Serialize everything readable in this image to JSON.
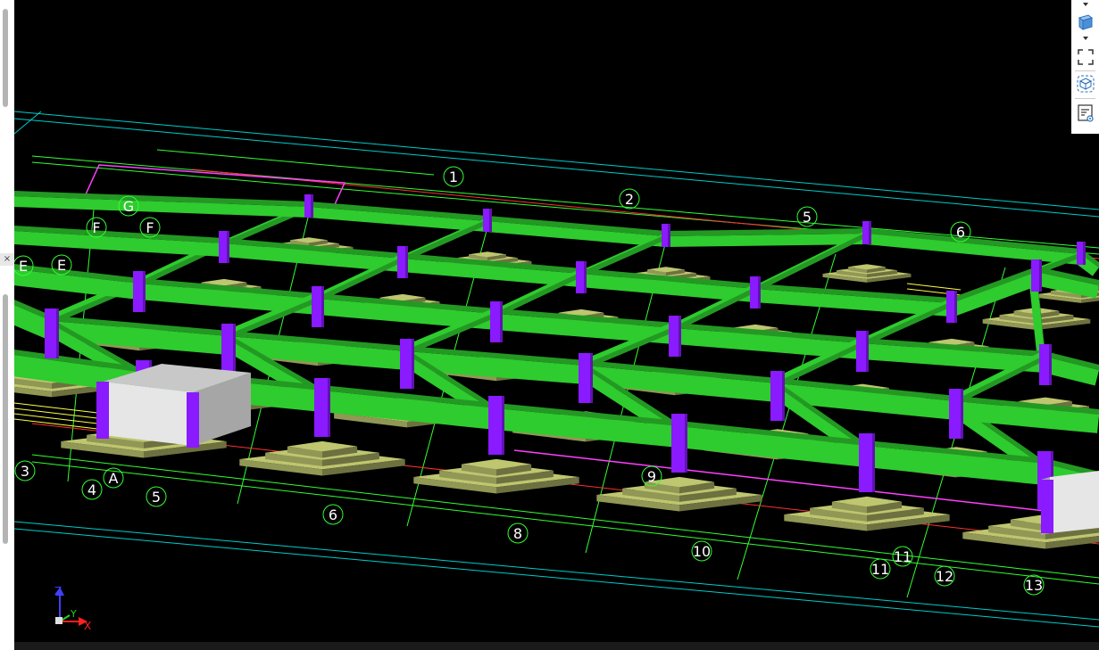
{
  "grid_labels": {
    "top": [
      "1",
      "2",
      "5",
      "6"
    ],
    "left": [
      "G",
      "F",
      "F",
      "E",
      "E"
    ],
    "bottom": [
      "3",
      "4",
      "A",
      "5",
      "6",
      "8",
      "10",
      "11",
      "11",
      "12",
      "13"
    ],
    "on_footings": [
      "9"
    ]
  },
  "axis_triad": {
    "z": "Z",
    "y": "Y",
    "x": "X"
  },
  "view_toolbar": {
    "items": [
      "view-cube-icon",
      "chevron-down-icon",
      "fit-view-icon",
      "orbit-icon",
      "layer-settings-icon"
    ]
  },
  "colors": {
    "beam": "#2ecc2e",
    "column": "#8a1aff",
    "footing": "#b5bd6a",
    "wall": "#e6e6e6",
    "grid_line": "#32ff32",
    "border_line": "#00cccc"
  },
  "left_tab": {
    "label": "×"
  }
}
